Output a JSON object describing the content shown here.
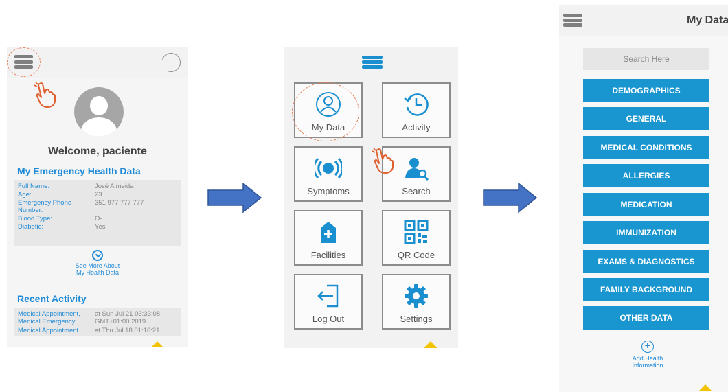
{
  "screen1": {
    "welcome": "Welcome, paciente",
    "section_health": "My Emergency Health Data",
    "health_rows": [
      {
        "label": "Full Name:",
        "value": "José Almeida"
      },
      {
        "label": "Age:",
        "value": "23"
      },
      {
        "label": "Emergency Phone Number:",
        "value": "351 977 777 777"
      },
      {
        "label": "Blood Type:",
        "value": "O-"
      },
      {
        "label": "Diabetic:",
        "value": "Yes"
      }
    ],
    "see_more_line1": "See More About",
    "see_more_line2": "My Health Data",
    "section_activity": "Recent Activity",
    "activity_rows": [
      {
        "label": "Medical Appointment, Medical Emergency...",
        "value": "at Sun Jul 21 03:33:08 GMT+01:00 2019"
      },
      {
        "label": "Medical Appointment",
        "value": "at Thu Jul 18 01:16:21"
      }
    ]
  },
  "screen2": {
    "tiles": [
      {
        "label": "My Data",
        "icon": "user-circle-icon"
      },
      {
        "label": "Activity",
        "icon": "clock-history-icon"
      },
      {
        "label": "Symptoms",
        "icon": "pulse-icon"
      },
      {
        "label": "Search",
        "icon": "user-search-icon"
      },
      {
        "label": "Facilities",
        "icon": "hospital-plus-icon"
      },
      {
        "label": "QR Code",
        "icon": "qr-code-icon"
      },
      {
        "label": "Log Out",
        "icon": "logout-icon"
      },
      {
        "label": "Settings",
        "icon": "gear-icon"
      }
    ]
  },
  "screen3": {
    "title": "My Data",
    "search_placeholder": "Search Here",
    "categories": [
      "DEMOGRAPHICS",
      "GENERAL",
      "MEDICAL CONDITIONS",
      "ALLERGIES",
      "MEDICATION",
      "IMMUNIZATION",
      "EXAMS & DIAGNOSTICS",
      "FAMILY BACKGROUND",
      "OTHER DATA"
    ],
    "add_line1": "Add Health",
    "add_line2": "Information"
  },
  "colors": {
    "accent_blue": "#1996cf",
    "link_blue": "#1f8ad6",
    "arrow_blue": "#4472c4",
    "highlight_orange": "#e6805a",
    "warning_yellow": "#f2c300"
  }
}
